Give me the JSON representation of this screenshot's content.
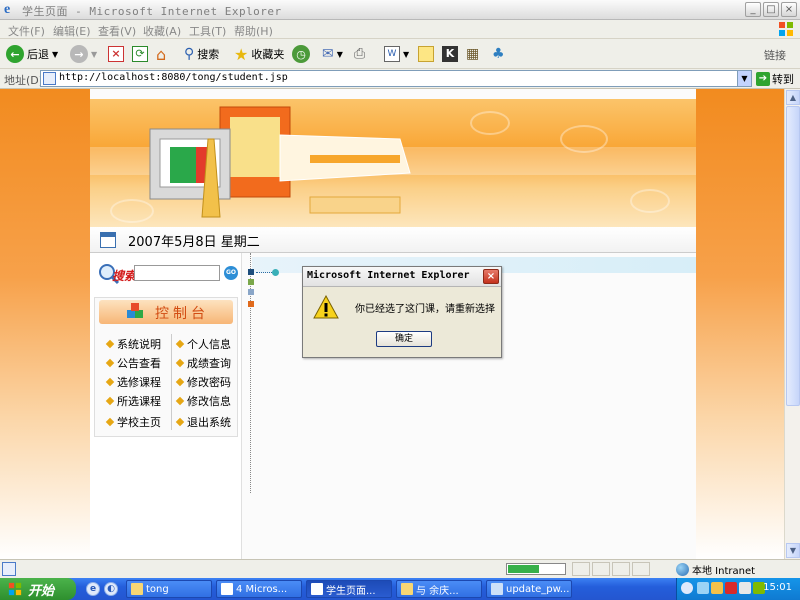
{
  "window": {
    "title": "学生页面 - Microsoft Internet Explorer",
    "buttons": {
      "minimize": "_",
      "maximize": "□",
      "close": "×"
    }
  },
  "menubar": [
    "文件(F)",
    "编辑(E)",
    "查看(V)",
    "收藏(A)",
    "工具(T)",
    "帮助(H)"
  ],
  "toolbar": {
    "back": "后退",
    "search": "搜索",
    "favorites": "收藏夹",
    "links": "链接"
  },
  "address": {
    "label": "地址(D)",
    "url": "http://localhost:8080/tong/student.jsp",
    "go": "转到"
  },
  "page": {
    "date": "2007年5月8日  星期二",
    "search": {
      "label": "搜索",
      "placeholder": "",
      "go": "GO"
    },
    "control_title": "控制台",
    "menu_left": [
      "系统说明",
      "公告查看",
      "选修课程",
      "所选课程",
      "学校主页"
    ],
    "menu_right": [
      "个人信息",
      "成绩查询",
      "修改密码",
      "修改信息",
      "退出系统"
    ]
  },
  "dialog": {
    "title": "Microsoft Internet Explorer",
    "message": "你已经选了这门课，请重新选择",
    "ok": "确定"
  },
  "statusbar": {
    "zone": "本地 Intranet",
    "progress": 0.55
  },
  "taskbar": {
    "start": "开始",
    "tasks": [
      "tong",
      "4 Micros...",
      "学生页面...",
      "与 余庆...",
      "update_pw..."
    ],
    "clock": "15:01"
  },
  "colors": {
    "accent_orange": "#F28B1F",
    "xp_blue": "#245EDB",
    "start_green": "#2E8F2E"
  }
}
